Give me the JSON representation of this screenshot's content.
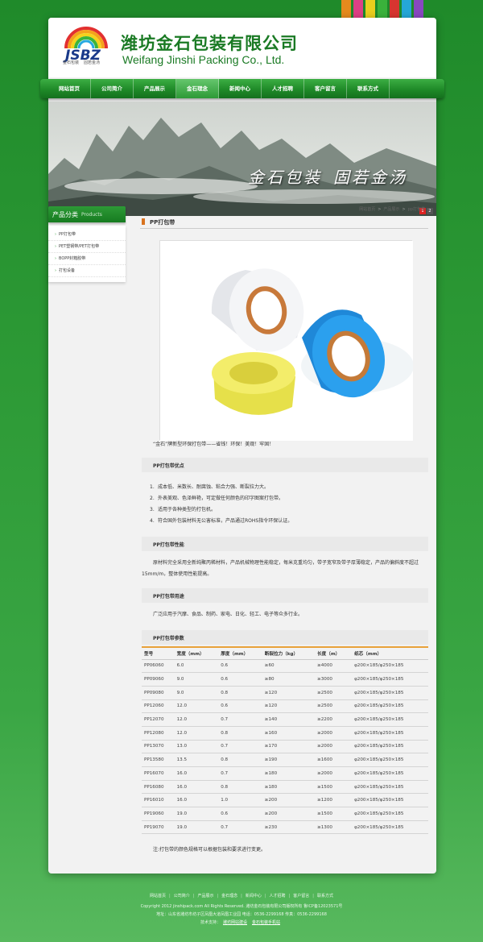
{
  "company": {
    "name_cn": "潍坊金石包装有限公司",
    "name_en": "Weifang Jinshi Packing Co., Ltd.",
    "logo_caption_left": "金石包装",
    "logo_caption_right": "固若金汤"
  },
  "nav": {
    "items": [
      "网站首页",
      "公司简介",
      "产品展示",
      "金石理念",
      "新闻中心",
      "人才招聘",
      "客户留言",
      "联系方式"
    ],
    "active_index": 3
  },
  "banner": {
    "text_1": "金石包装",
    "text_2": "固若金汤",
    "pager": [
      "1",
      "2"
    ]
  },
  "sidebar": {
    "title_cn": "产品分类",
    "title_en": "Products",
    "items": [
      "PP打包带",
      "PET塑钢带/PET打包带",
      "BOPP封箱胶带",
      "打包设备"
    ]
  },
  "breadcrumb": [
    "网站首页",
    "产品展示",
    "pp打包带"
  ],
  "page_title": "PP打包带",
  "caption": "“金石”牌新型环保打包带——省钱！环保！美观！牢固！",
  "sections": {
    "advantages_title": "PP打包带优点",
    "advantages": [
      "成本低、米数长、耐腐蚀、粘合力强、断裂拉力大。",
      "外表美观、色泽鲜艳，可定做任何颜色的印字图案打包带。",
      "适用于各种类型的打包机。",
      "符合国外包装材料无公害标准，产品通过ROHS指令环保认证。"
    ],
    "performance_title": "PP打包带性能",
    "performance_text": "原材料完全采用全新纯聚丙稀材料，产品机械物理性能稳定，每米克重均匀，带子宽窄及带子厚薄稳定，产品的偏斜度不超过15mm/m，整体使用性能提高。",
    "usage_title": "PP打包带用途",
    "usage_text": "广泛应用于汽摩、食品、制药、家电、日化、轻工、电子等众多行业。",
    "params_title": "PP打包带参数"
  },
  "spec_table": {
    "headers": [
      "型号",
      "宽度（mm）",
      "厚度（mm）",
      "断裂拉力（kg）",
      "长度（m）",
      "纸芯（mm）"
    ],
    "rows": [
      [
        "PP06060",
        "6.0",
        "0.6",
        "≥60",
        "≥4000",
        "φ200×185/φ250×185"
      ],
      [
        "PP09060",
        "9.0",
        "0.6",
        "≥80",
        "≥3000",
        "φ200×185/φ250×185"
      ],
      [
        "PP09080",
        "9.0",
        "0.8",
        "≥120",
        "≥2500",
        "φ200×185/φ250×185"
      ],
      [
        "PP12060",
        "12.0",
        "0.6",
        "≥120",
        "≥2500",
        "φ200×185/φ250×185"
      ],
      [
        "PP12070",
        "12.0",
        "0.7",
        "≥140",
        "≥2200",
        "φ200×185/φ250×185"
      ],
      [
        "PP12080",
        "12.0",
        "0.8",
        "≥160",
        "≥2000",
        "φ200×185/φ250×185"
      ],
      [
        "PP13070",
        "13.0",
        "0.7",
        "≥170",
        "≥2000",
        "φ200×185/φ250×185"
      ],
      [
        "PP13580",
        "13.5",
        "0.8",
        "≥190",
        "≥1600",
        "φ200×185/φ250×185"
      ],
      [
        "PP16070",
        "16.0",
        "0.7",
        "≥180",
        "≥2000",
        "φ200×185/φ250×185"
      ],
      [
        "PP16080",
        "16.0",
        "0.8",
        "≥180",
        "≥1500",
        "φ200×185/φ250×185"
      ],
      [
        "PP16010",
        "16.0",
        "1.0",
        "≥200",
        "≥1200",
        "φ200×185/φ250×185"
      ],
      [
        "PP19060",
        "19.0",
        "0.6",
        "≥200",
        "≥1500",
        "φ200×185/φ250×185"
      ],
      [
        "PP19070",
        "19.0",
        "0.7",
        "≥230",
        "≥1300",
        "φ200×185/φ250×185"
      ]
    ]
  },
  "note": "注:打包带的颜色规格可以根据包装和要求进行变更。",
  "footer": {
    "links": [
      "网站首页",
      "公司简介",
      "产品展示",
      "金石理念",
      "新闻中心",
      "人才招聘",
      "客户留言",
      "联系方式"
    ],
    "copyright": "Copyright 2012 jinshipack.com All Rights Reserved. 潍坊金石包装有限公司版权所有 鲁ICP备12023571号",
    "address": "地址：山东省潍坊市坊子区凤凰大道凤凰工业园   电话：0536-2299168   传真：0536-2299168",
    "support_label": "技术支持：",
    "support_link_1": "潍坊网站建设",
    "support_link_2": "金石包装手机站"
  },
  "colors": {
    "brand_green": "#1f8a2a",
    "accent_orange": "#e8a23a",
    "stripes": [
      "#f08a1c",
      "#e83c8a",
      "#f5d21c",
      "#3cb43c",
      "#e23030",
      "#26a9e0",
      "#8e44c8"
    ]
  }
}
